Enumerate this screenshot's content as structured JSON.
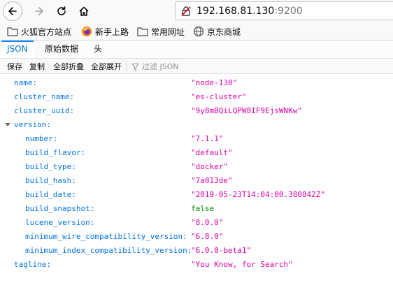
{
  "browser": {
    "url_host": "192.168.81.130",
    "url_port": ":9200"
  },
  "bookmarks": [
    {
      "label": "火狐官方站点",
      "icon": "folder-icon"
    },
    {
      "label": "新手上路",
      "icon": "firefox-icon"
    },
    {
      "label": "常用网址",
      "icon": "folder-icon"
    },
    {
      "label": "京东商城",
      "icon": "globe-icon"
    }
  ],
  "tabs": [
    {
      "label": "JSON"
    },
    {
      "label": "原始数据"
    },
    {
      "label": "头"
    }
  ],
  "actions": {
    "save": "保存",
    "copy": "复制",
    "collapse_all": "全部折叠",
    "expand_all": "全部展开",
    "filter_placeholder": "过滤 JSON"
  },
  "json": {
    "name": {
      "key": "name:",
      "value": "\"node-130\""
    },
    "cluster_name": {
      "key": "cluster_name:",
      "value": "\"es-cluster\""
    },
    "cluster_uuid": {
      "key": "cluster_uuid:",
      "value": "\"9y8mBQiLQPW8IF9EjsWNKw\""
    },
    "version": {
      "key": "version:"
    },
    "number": {
      "key": "number:",
      "value": "\"7.1.1\""
    },
    "build_flavor": {
      "key": "build_flavor:",
      "value": "\"default\""
    },
    "build_type": {
      "key": "build_type:",
      "value": "\"docker\""
    },
    "build_hash": {
      "key": "build_hash:",
      "value": "\"7a013de\""
    },
    "build_date": {
      "key": "build_date:",
      "value": "\"2019-05-23T14:04:00.380842Z\""
    },
    "build_snapshot": {
      "key": "build_snapshot:",
      "value": "false"
    },
    "lucene_version": {
      "key": "lucene_version:",
      "value": "\"8.0.0\""
    },
    "minimum_wire_compatibility_version": {
      "key": "minimum_wire_compatibility_version:",
      "value": "\"6.8.0\""
    },
    "minimum_index_compatibility_version": {
      "key": "minimum_index_compatibility_version:",
      "value": "\"6.0.0-beta1\""
    },
    "tagline": {
      "key": "tagline:",
      "value": "\"You Know, for Search\""
    }
  }
}
